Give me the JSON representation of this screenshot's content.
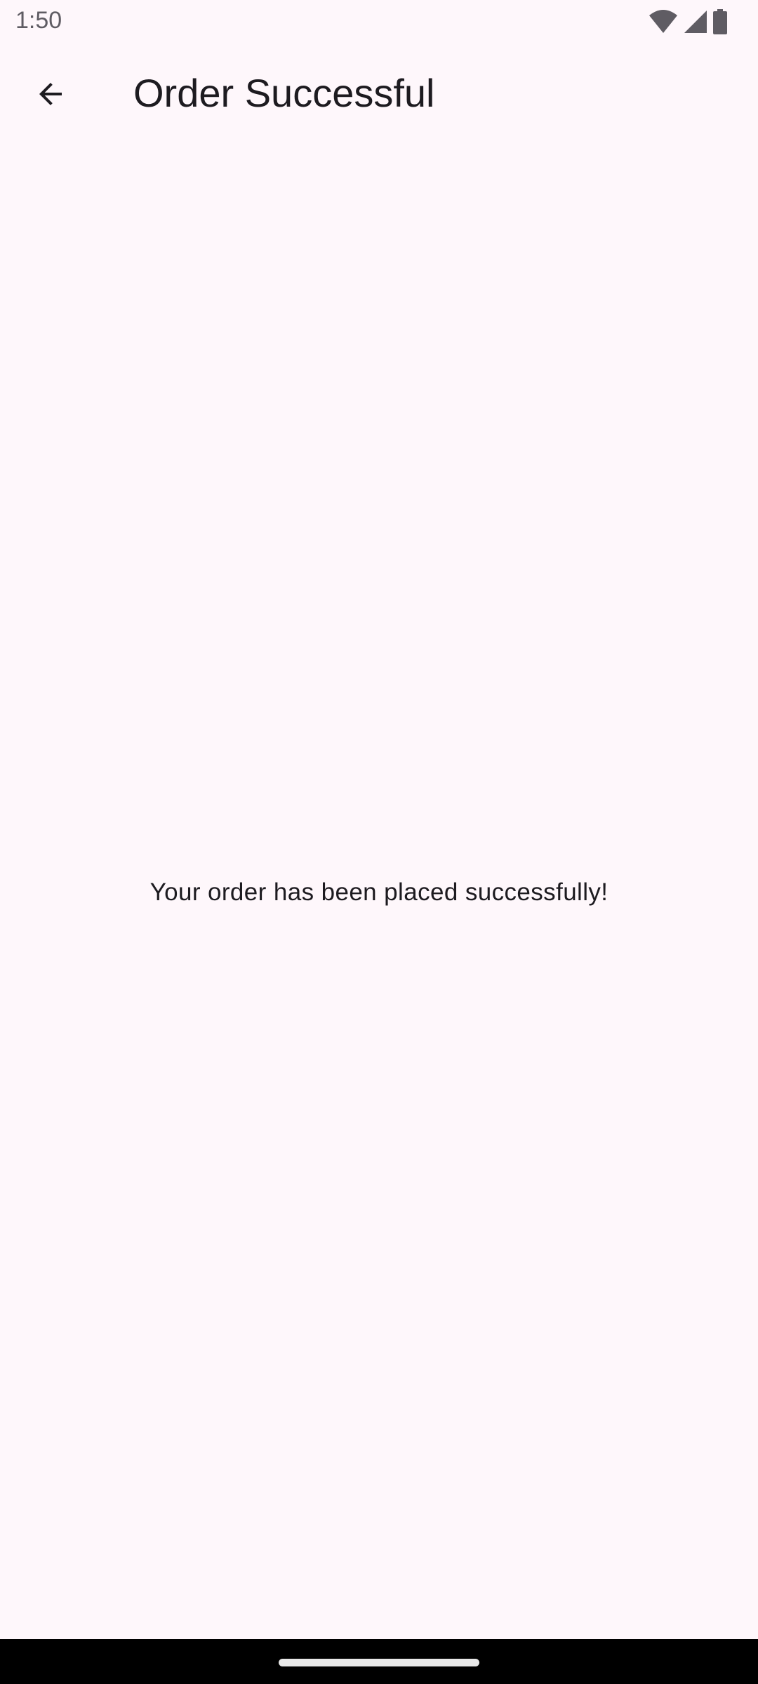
{
  "status_bar": {
    "time": "1:50",
    "icons": [
      "wifi-icon",
      "signal-icon",
      "battery-icon"
    ]
  },
  "app_bar": {
    "title": "Order Successful",
    "back_icon": "arrow-back-icon"
  },
  "main": {
    "message": "Your order has been placed successfully!"
  },
  "colors": {
    "background": "#fef7fb",
    "text": "#1d1b20",
    "status_icons": "#5f5c63",
    "nav_bar": "#000000"
  }
}
